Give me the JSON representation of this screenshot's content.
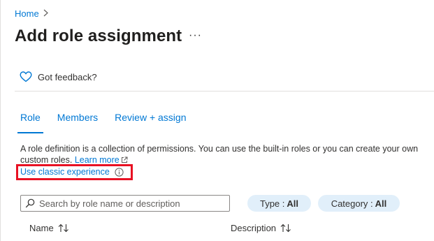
{
  "breadcrumb": {
    "home_label": "Home"
  },
  "page": {
    "title": "Add role assignment",
    "more_label": "···"
  },
  "feedback": {
    "label": "Got feedback?"
  },
  "tabs": [
    {
      "label": "Role",
      "active": true
    },
    {
      "label": "Members",
      "active": false
    },
    {
      "label": "Review + assign",
      "active": false
    }
  ],
  "description": {
    "text": "A role definition is a collection of permissions. You can use the built-in roles or you can create your own custom roles.",
    "learn_more_label": "Learn more"
  },
  "classic": {
    "label": "Use classic experience"
  },
  "search": {
    "placeholder": "Search by role name or description",
    "value": ""
  },
  "filters": {
    "type": {
      "label": "Type :",
      "value": "All"
    },
    "category": {
      "label": "Category :",
      "value": "All"
    }
  },
  "table": {
    "columns": [
      "Name",
      "Description"
    ]
  },
  "colors": {
    "accent": "#0078d4",
    "highlight_border": "#e81123",
    "pill_bg": "#e1effa"
  },
  "icons": [
    "chevron-right-icon",
    "more-icon",
    "heart-icon",
    "external-link-icon",
    "info-icon",
    "search-icon",
    "sort-icon"
  ]
}
